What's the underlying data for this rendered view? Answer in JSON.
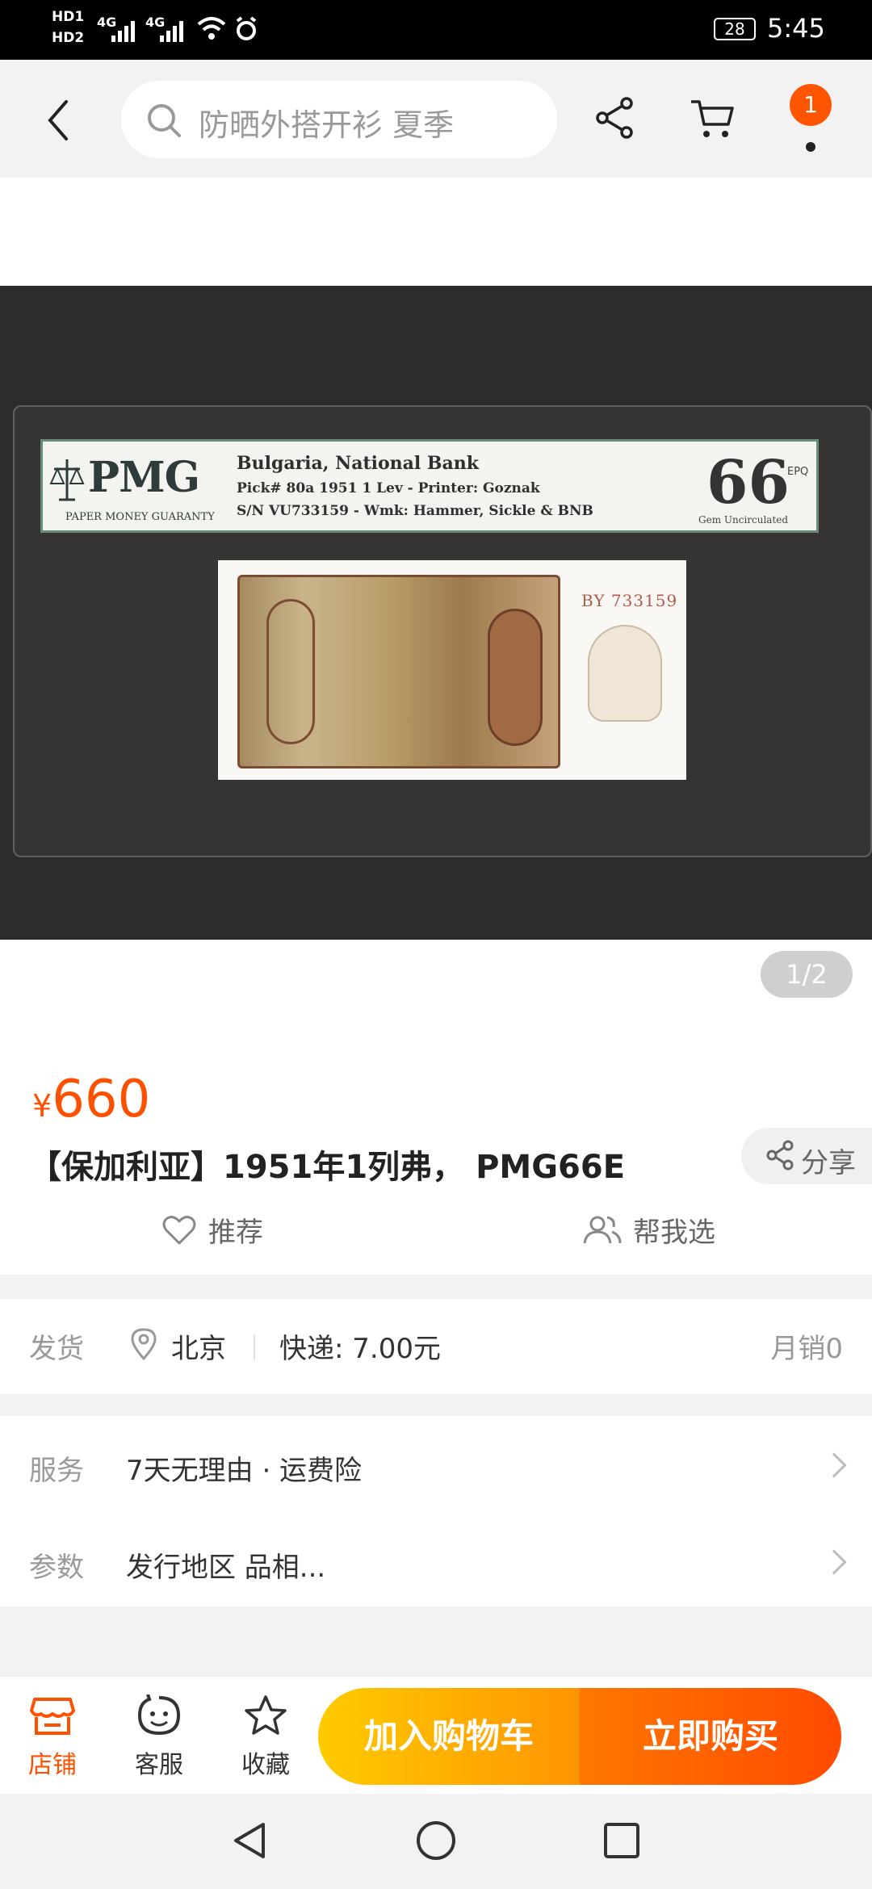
{
  "status_bar": {
    "hd_top": "HD1",
    "hd_bottom": "HD2",
    "signal_1": "4G",
    "signal_2": "4G",
    "battery": "28",
    "time": "5:45"
  },
  "top_nav": {
    "search_placeholder": "防晒外搭开衫 夏季",
    "cart_badge": "1"
  },
  "gallery": {
    "pager": "1/2",
    "label": {
      "brand": "PMG",
      "brand_sub": "PAPER MONEY GUARANTY",
      "line1": "Bulgaria, National Bank",
      "line2": "Pick# 80a  1951  1 Lev - Printer: Goznak",
      "line3": "S/N VU733159 - Wmk: Hammer, Sickle & BNB",
      "grade": "66",
      "grade_tag": "EPQ",
      "grade_desc": "Gem Uncirculated"
    },
    "note_serial": "BY 733159"
  },
  "product": {
    "currency": "¥",
    "price": "660",
    "title": "【保加利亚】1951年1列弗， PMG66E",
    "share_label": "分享",
    "recommend_label": "推荐",
    "help_choose_label": "帮我选"
  },
  "shipping": {
    "label": "发货",
    "city": "北京",
    "fee": "快递: 7.00元",
    "monthly_sales": "月销0"
  },
  "services": {
    "service_label": "服务",
    "service_value": "7天无理由 · 运费险",
    "params_label": "参数",
    "params_value": "发行地区 品相..."
  },
  "bottom_bar": {
    "store": "店铺",
    "service": "客服",
    "favorite": "收藏",
    "add_to_cart": "加入购物车",
    "buy_now": "立即购买",
    "accent": "#ff5000"
  }
}
